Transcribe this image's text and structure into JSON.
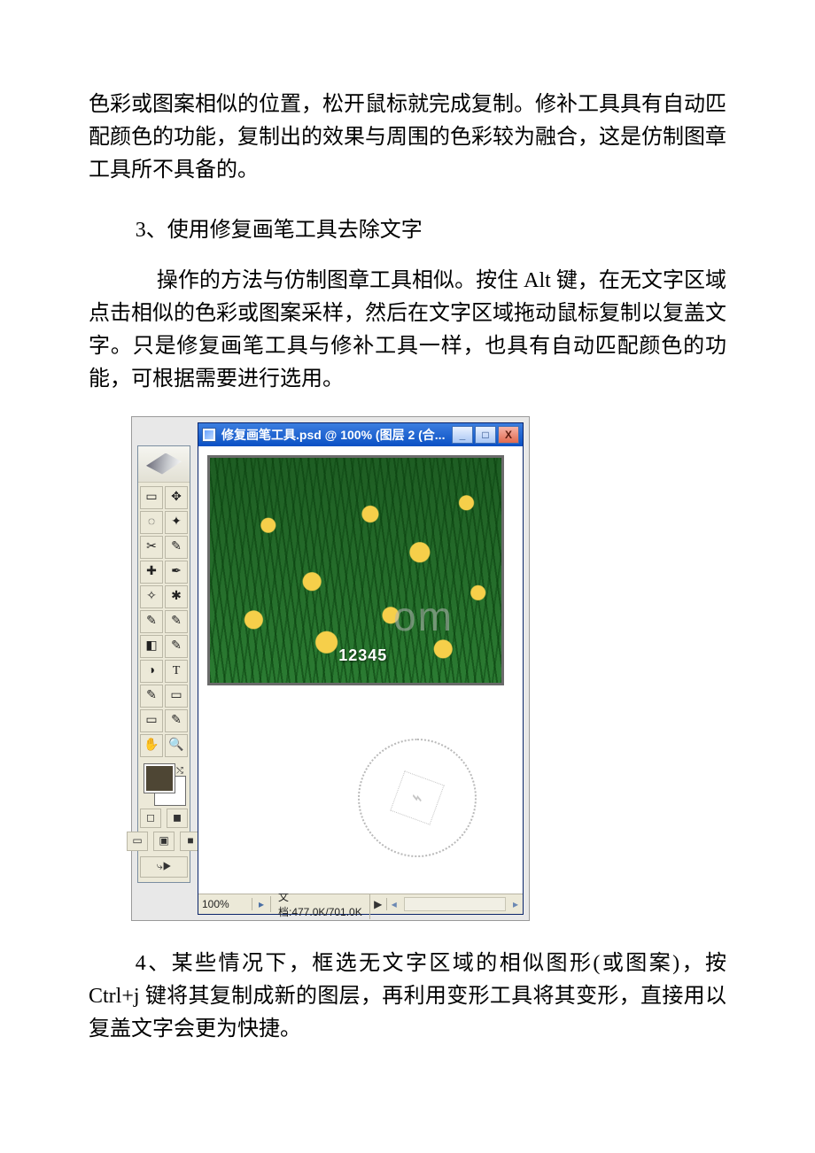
{
  "paragraphs": {
    "p1": "色彩或图案相似的位置，松开鼠标就完成复制。修补工具具有自动匹配颜色的功能，复制出的效果与周围的色彩较为融合，这是仿制图章工具所不具备的。",
    "h3": "3、使用修复画笔工具去除文字",
    "p3": "操作的方法与仿制图章工具相似。按住 Alt 键，在无文字区域点击相似的色彩或图案采样，然后在文字区域拖动鼠标复制以复盖文字。只是修复画笔工具与修补工具一样，也具有自动匹配颜色的功能，可根据需要进行选用。",
    "p4": "4、某些情况下，框选无文字区域的相似图形(或图案)，按 Ctrl+j 键将其复制成新的图层，再利用变形工具将其变形，直接用以复盖文字会更为快捷。"
  },
  "window": {
    "title": "修复画笔工具.psd @ 100% (图层 2 (合...",
    "minimize": "_",
    "maximize": "□",
    "close": "X",
    "zoom": "100%",
    "doc_size": "文档:477.0K/701.0K",
    "image_label": "12345",
    "scroll_play": "▶",
    "scroll_left": "◂",
    "scroll_right": "▸"
  },
  "watermark": "om",
  "toolbox": {
    "tools": [
      "▭",
      "✥",
      "◌",
      "✦",
      "✂",
      "✎",
      "✚",
      "✒",
      "✧",
      "✱",
      "✎",
      "✎",
      "◧",
      "✎",
      "◑",
      "▭",
      "◒",
      "✎",
      "✎",
      "T",
      "✎",
      "▭",
      "▭",
      "✎",
      "✋",
      "🔍"
    ],
    "bottom_go": "⤷▶"
  }
}
